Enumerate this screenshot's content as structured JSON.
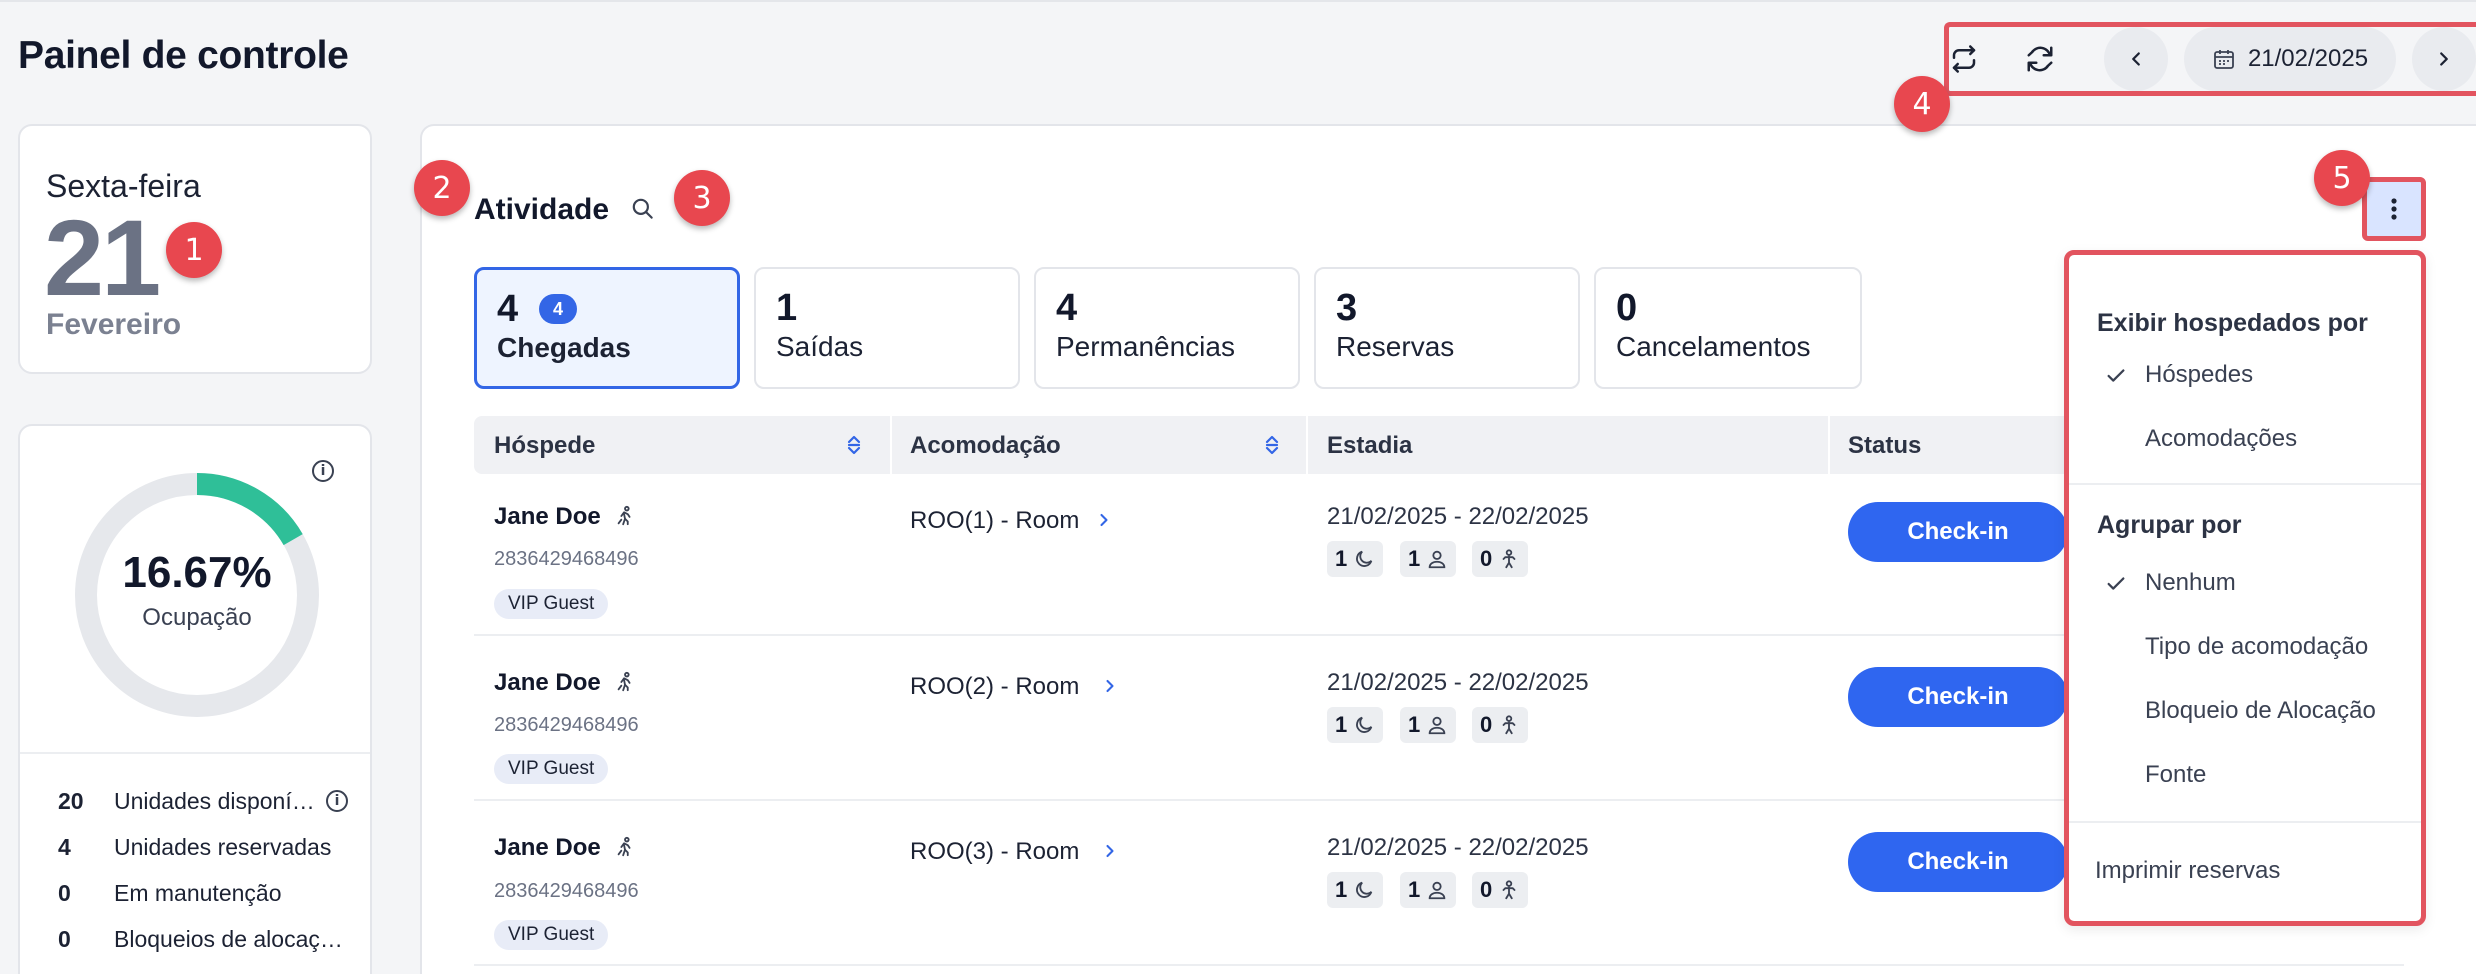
{
  "page_title": "Painel de controle",
  "toolbar": {
    "date": "21/02/2025"
  },
  "date_card": {
    "weekday": "Sexta-feira",
    "day": "21",
    "month": "Fevereiro"
  },
  "occupancy": {
    "percent_label": "16.67%",
    "percent_value": 16.67,
    "label": "Ocupação",
    "stats": [
      {
        "num": "20",
        "label": "Unidades disponí…"
      },
      {
        "num": "4",
        "label": "Unidades reservadas"
      },
      {
        "num": "0",
        "label": "Em manutenção"
      },
      {
        "num": "0",
        "label": "Bloqueios de alocaç…"
      }
    ]
  },
  "activity": {
    "title": "Atividade",
    "tabs": [
      {
        "count": "4",
        "badge": "4",
        "label": "Chegadas",
        "active": true
      },
      {
        "count": "1",
        "label": "Saídas"
      },
      {
        "count": "4",
        "label": "Permanências"
      },
      {
        "count": "3",
        "label": "Reservas"
      },
      {
        "count": "0",
        "label": "Cancelamentos"
      }
    ],
    "columns": [
      "Hóspede",
      "Acomodação",
      "Estadia",
      "Status"
    ],
    "rows": [
      {
        "name": "Jane Doe",
        "id": "2836429468496",
        "tag": "VIP Guest",
        "room": "ROO(1) - Room",
        "stay": "21/02/2025 - 22/02/2025",
        "nights": "1",
        "adults": "1",
        "children": "0",
        "action": "Check-in"
      },
      {
        "name": "Jane Doe",
        "id": "2836429468496",
        "tag": "VIP Guest",
        "room": "ROO(2) - Room",
        "stay": "21/02/2025 - 22/02/2025",
        "nights": "1",
        "adults": "1",
        "children": "0",
        "action": "Check-in"
      },
      {
        "name": "Jane Doe",
        "id": "2836429468496",
        "tag": "VIP Guest",
        "room": "ROO(3) - Room",
        "stay": "21/02/2025 - 22/02/2025",
        "nights": "1",
        "adults": "1",
        "children": "0",
        "action": "Check-in"
      }
    ]
  },
  "menu": {
    "display_heading": "Exibir hospedados por",
    "display_options": [
      "Hóspedes",
      "Acomodações"
    ],
    "group_heading": "Agrupar por",
    "group_options": [
      "Nenhum",
      "Tipo de acomodação",
      "Bloqueio de Alocação",
      "Fonte"
    ],
    "print": "Imprimir reservas"
  },
  "annotations": [
    "1",
    "2",
    "3",
    "4",
    "5"
  ],
  "colors": {
    "primary": "#2f66f0",
    "highlight": "#e2545f",
    "donut_fill": "#2fbf98",
    "donut_track": "#e6e8ec"
  }
}
